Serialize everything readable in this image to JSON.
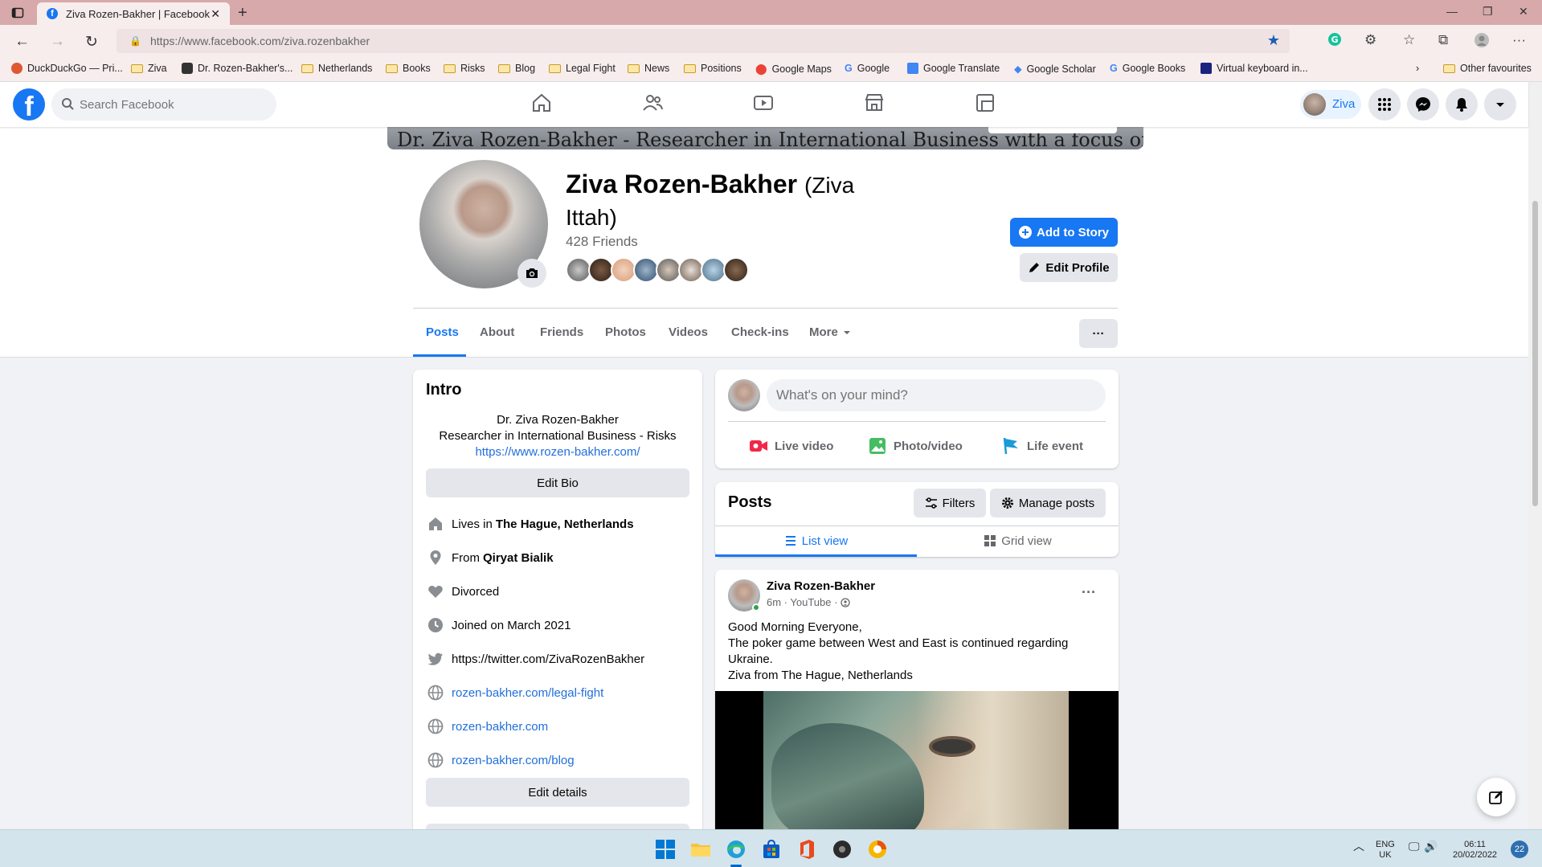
{
  "browser": {
    "tab_title": "Ziva Rozen-Bakher | Facebook",
    "url_prefix": "https://www.facebook.com",
    "url_path": "/ziva.rozenbakher",
    "bookmarks": [
      "DuckDuckGo — Pri...",
      "Ziva",
      "Dr. Rozen-Bakher's...",
      "Netherlands",
      "Books",
      "Risks",
      "Blog",
      "Legal Fight",
      "News",
      "Positions",
      "Google Maps",
      "Google",
      "Google Translate",
      "Google Scholar",
      "Google Books",
      "Virtual keyboard in...",
      "Other favourites"
    ]
  },
  "fb_header": {
    "search_placeholder": "Search Facebook",
    "user_chip": "Ziva"
  },
  "profile": {
    "cover_text": "Dr. Ziva Rozen-Bakher - Researcher in International Business with a focus on Risks",
    "name": "Ziva Rozen-Bakher",
    "alt_name": "(Ziva Ittah)",
    "friends_count": "428 Friends",
    "add_story": "Add to Story",
    "edit_profile": "Edit Profile",
    "tabs": [
      "Posts",
      "About",
      "Friends",
      "Photos",
      "Videos",
      "Check-ins",
      "More"
    ],
    "more_glyph": "···"
  },
  "intro": {
    "title": "Intro",
    "bio_lines": [
      "Dr. Ziva Rozen-Bakher",
      "Researcher in International Business - Risks"
    ],
    "bio_link": "https://www.rozen-bakher.com/",
    "edit_bio": "Edit Bio",
    "lives_prefix": "Lives in",
    "lives_place": "The Hague, Netherlands",
    "from_prefix": "From",
    "from_place": "Qiryat Bialik",
    "relationship": "Divorced",
    "joined": "Joined on March 2021",
    "twitter": "https://twitter.com/ZivaRozenBakher",
    "links": [
      "rozen-bakher.com/legal-fight",
      "rozen-bakher.com",
      "rozen-bakher.com/blog"
    ],
    "edit_details": "Edit details"
  },
  "composer": {
    "placeholder": "What's on your mind?",
    "actions": [
      "Live video",
      "Photo/video",
      "Life event"
    ]
  },
  "posts_panel": {
    "title": "Posts",
    "filters": "Filters",
    "manage": "Manage posts",
    "list_view": "List view",
    "grid_view": "Grid view"
  },
  "post": {
    "author": "Ziva Rozen-Bakher",
    "meta": "6m · YouTube ·",
    "lines": [
      "Good Morning Everyone,",
      "The poker game between West and East is continued regarding Ukraine.",
      "Ziva from The Hague, Netherlands"
    ]
  },
  "taskbar": {
    "lang_top": "ENG",
    "lang_bottom": "UK",
    "time": "06:11",
    "date": "20/02/2022",
    "notif_count": "22"
  },
  "colors": {
    "fb_blue": "#1877f2",
    "tab_bar": "#d7a9ab",
    "chrome_bg": "#f7eded"
  }
}
